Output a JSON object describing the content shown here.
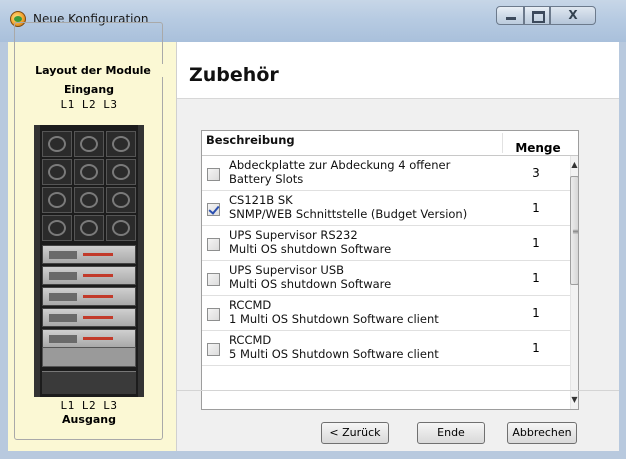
{
  "window": {
    "title": "Neue Konfiguration",
    "close_label": "X"
  },
  "left": {
    "group_title": "Layout der Module",
    "input_label": "Eingang",
    "phase_labels_top": "L1 L2 L3",
    "phase_labels_bottom": "L1 L2 L3",
    "output_label": "Ausgang"
  },
  "header": {
    "title": "Zubehör"
  },
  "table": {
    "col_description": "Beschreibung",
    "col_quantity": "Menge",
    "rows": [
      {
        "line1": "Abdeckplatte zur Abdeckung 4 offener",
        "line2": "Battery Slots",
        "qty": "3",
        "checked": false
      },
      {
        "line1": "CS121B SK",
        "line2": "SNMP/WEB Schnittstelle (Budget Version)",
        "qty": "1",
        "checked": true
      },
      {
        "line1": "UPS Supervisor RS232",
        "line2": "Multi OS shutdown Software",
        "qty": "1",
        "checked": false
      },
      {
        "line1": "UPS Supervisor USB",
        "line2": "Multi OS shutdown Software",
        "qty": "1",
        "checked": false
      },
      {
        "line1": "RCCMD",
        "line2": "1 Multi OS Shutdown Software client",
        "qty": "1",
        "checked": false
      },
      {
        "line1": "RCCMD",
        "line2": "5 Multi OS Shutdown Software client",
        "qty": "1",
        "checked": false
      }
    ]
  },
  "buttons": {
    "back": "< Zurück",
    "end": "Ende",
    "cancel": "Abbrechen"
  },
  "icons": {
    "app": "ups-globe-icon",
    "minimize": "minimize-icon",
    "maximize": "maximize-icon",
    "close": "close-icon"
  }
}
